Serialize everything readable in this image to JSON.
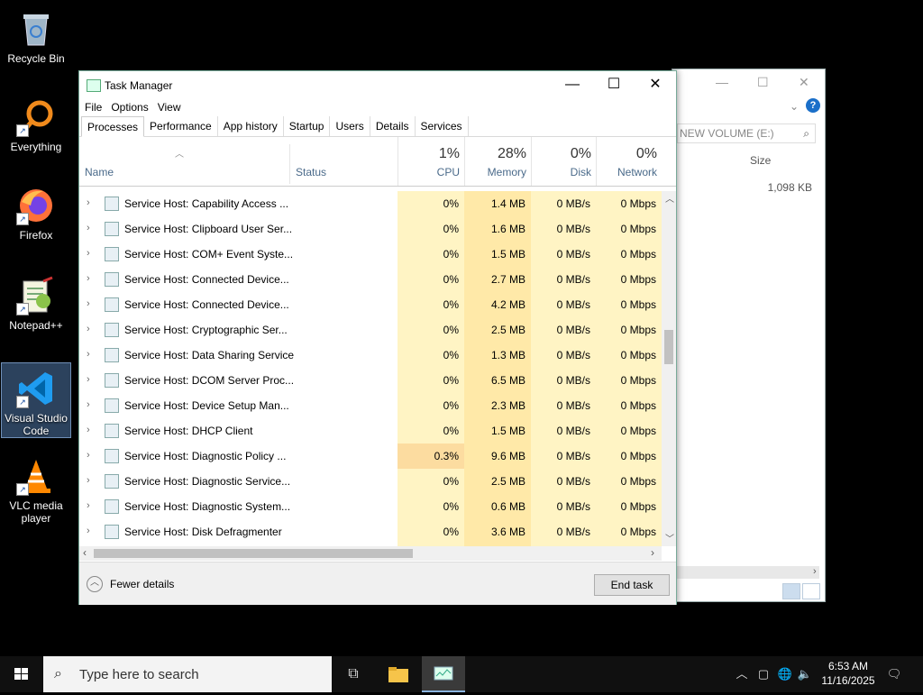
{
  "desktop_icons": [
    {
      "label": "Recycle Bin",
      "icon": "recycle-bin-icon"
    },
    {
      "label": "Everything",
      "icon": "everything-search-icon"
    },
    {
      "label": "Firefox",
      "icon": "firefox-icon"
    },
    {
      "label": "Notepad++",
      "icon": "notepad-plus-plus-icon"
    },
    {
      "label": "Visual Studio Code",
      "icon": "vscode-icon"
    },
    {
      "label": "VLC media player",
      "icon": "vlc-icon"
    }
  ],
  "explorer": {
    "search_placeholder": "NEW VOLUME (E:)",
    "size_header": "Size",
    "size_value": "1,098 KB"
  },
  "task_manager": {
    "title": "Task Manager",
    "menu": [
      "File",
      "Options",
      "View"
    ],
    "tabs": [
      "Processes",
      "Performance",
      "App history",
      "Startup",
      "Users",
      "Details",
      "Services"
    ],
    "active_tab": "Processes",
    "columns": {
      "name": "Name",
      "status": "Status",
      "cpu": {
        "pct": "1%",
        "label": "CPU"
      },
      "memory": {
        "pct": "28%",
        "label": "Memory"
      },
      "disk": {
        "pct": "0%",
        "label": "Disk"
      },
      "network": {
        "pct": "0%",
        "label": "Network"
      }
    },
    "processes": [
      {
        "name": "Service Host: Capability Access ...",
        "cpu": "0%",
        "memory": "1.4 MB",
        "disk": "0 MB/s",
        "network": "0 Mbps"
      },
      {
        "name": "Service Host: Clipboard User Ser...",
        "cpu": "0%",
        "memory": "1.6 MB",
        "disk": "0 MB/s",
        "network": "0 Mbps"
      },
      {
        "name": "Service Host: COM+ Event Syste...",
        "cpu": "0%",
        "memory": "1.5 MB",
        "disk": "0 MB/s",
        "network": "0 Mbps"
      },
      {
        "name": "Service Host: Connected Device...",
        "cpu": "0%",
        "memory": "2.7 MB",
        "disk": "0 MB/s",
        "network": "0 Mbps"
      },
      {
        "name": "Service Host: Connected Device...",
        "cpu": "0%",
        "memory": "4.2 MB",
        "disk": "0 MB/s",
        "network": "0 Mbps"
      },
      {
        "name": "Service Host: Cryptographic Ser...",
        "cpu": "0%",
        "memory": "2.5 MB",
        "disk": "0 MB/s",
        "network": "0 Mbps"
      },
      {
        "name": "Service Host: Data Sharing Service",
        "cpu": "0%",
        "memory": "1.3 MB",
        "disk": "0 MB/s",
        "network": "0 Mbps"
      },
      {
        "name": "Service Host: DCOM Server Proc...",
        "cpu": "0%",
        "memory": "6.5 MB",
        "disk": "0 MB/s",
        "network": "0 Mbps"
      },
      {
        "name": "Service Host: Device Setup Man...",
        "cpu": "0%",
        "memory": "2.3 MB",
        "disk": "0 MB/s",
        "network": "0 Mbps"
      },
      {
        "name": "Service Host: DHCP Client",
        "cpu": "0%",
        "memory": "1.5 MB",
        "disk": "0 MB/s",
        "network": "0 Mbps"
      },
      {
        "name": "Service Host: Diagnostic Policy ...",
        "cpu": "0.3%",
        "memory": "9.6 MB",
        "disk": "0 MB/s",
        "network": "0 Mbps"
      },
      {
        "name": "Service Host: Diagnostic Service...",
        "cpu": "0%",
        "memory": "2.5 MB",
        "disk": "0 MB/s",
        "network": "0 Mbps"
      },
      {
        "name": "Service Host: Diagnostic System...",
        "cpu": "0%",
        "memory": "0.6 MB",
        "disk": "0 MB/s",
        "network": "0 Mbps"
      },
      {
        "name": "Service Host: Disk Defragmenter",
        "cpu": "0%",
        "memory": "3.6 MB",
        "disk": "0 MB/s",
        "network": "0 Mbps"
      }
    ],
    "fewer_details": "Fewer details",
    "end_task": "End task"
  },
  "taskbar": {
    "search_placeholder": "Type here to search",
    "time": "6:53 AM",
    "date": "11/16/2025"
  },
  "colors": {
    "heat_light": "#fff4c4",
    "heat_medium": "#ffe9a8",
    "heat_active": "#fcdca0",
    "accent": "#0078d7"
  }
}
